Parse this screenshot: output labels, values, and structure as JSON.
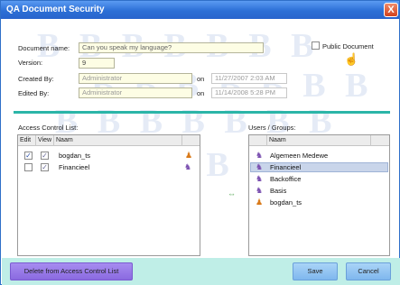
{
  "window": {
    "title": "QA Document Security",
    "close_glyph": "X"
  },
  "watermark": {
    "text": "B B B B B B B"
  },
  "form": {
    "document_name_label": "Document name:",
    "document_name_value": "Can you speak my language?",
    "version_label": "Version:",
    "version_value": "9",
    "created_by_label": "Created By:",
    "created_by_value": "Administrator",
    "created_on_label": "on",
    "created_on_value": "11/27/2007 2:03 AM",
    "edited_by_label": "Edited By:",
    "edited_by_value": "Administrator",
    "edited_on_label": "on",
    "edited_on_value": "11/14/2008 5:28 PM",
    "public_document_label": "Public Document",
    "public_document_checked": false
  },
  "acl": {
    "title": "Access Control List:",
    "columns": [
      "Edit",
      "View",
      "Naam"
    ],
    "rows": [
      {
        "name": "bogdan_ts",
        "edit": true,
        "view": true,
        "icon": "user-icon"
      },
      {
        "name": "Financieel",
        "edit": false,
        "view": true,
        "icon": "group-icon"
      }
    ]
  },
  "users_groups": {
    "title": "Users / Groups:",
    "columns": [
      "Naam"
    ],
    "rows": [
      {
        "name": "Algemeen Medewe",
        "icon": "group-icon",
        "selected": false
      },
      {
        "name": "Financieel",
        "icon": "group-icon",
        "selected": true
      },
      {
        "name": "Backoffice",
        "icon": "group-icon",
        "selected": false
      },
      {
        "name": "Basis",
        "icon": "group-icon",
        "selected": false
      },
      {
        "name": "bogdan_ts",
        "icon": "user-icon",
        "selected": false
      }
    ]
  },
  "buttons": {
    "delete_label": "Delete from Access Control List",
    "save_label": "Save",
    "cancel_label": "Cancel"
  },
  "colors": {
    "titlebar": "#2c6fd6",
    "divider": "#2bb5a8",
    "footer": "#bfeee7"
  }
}
